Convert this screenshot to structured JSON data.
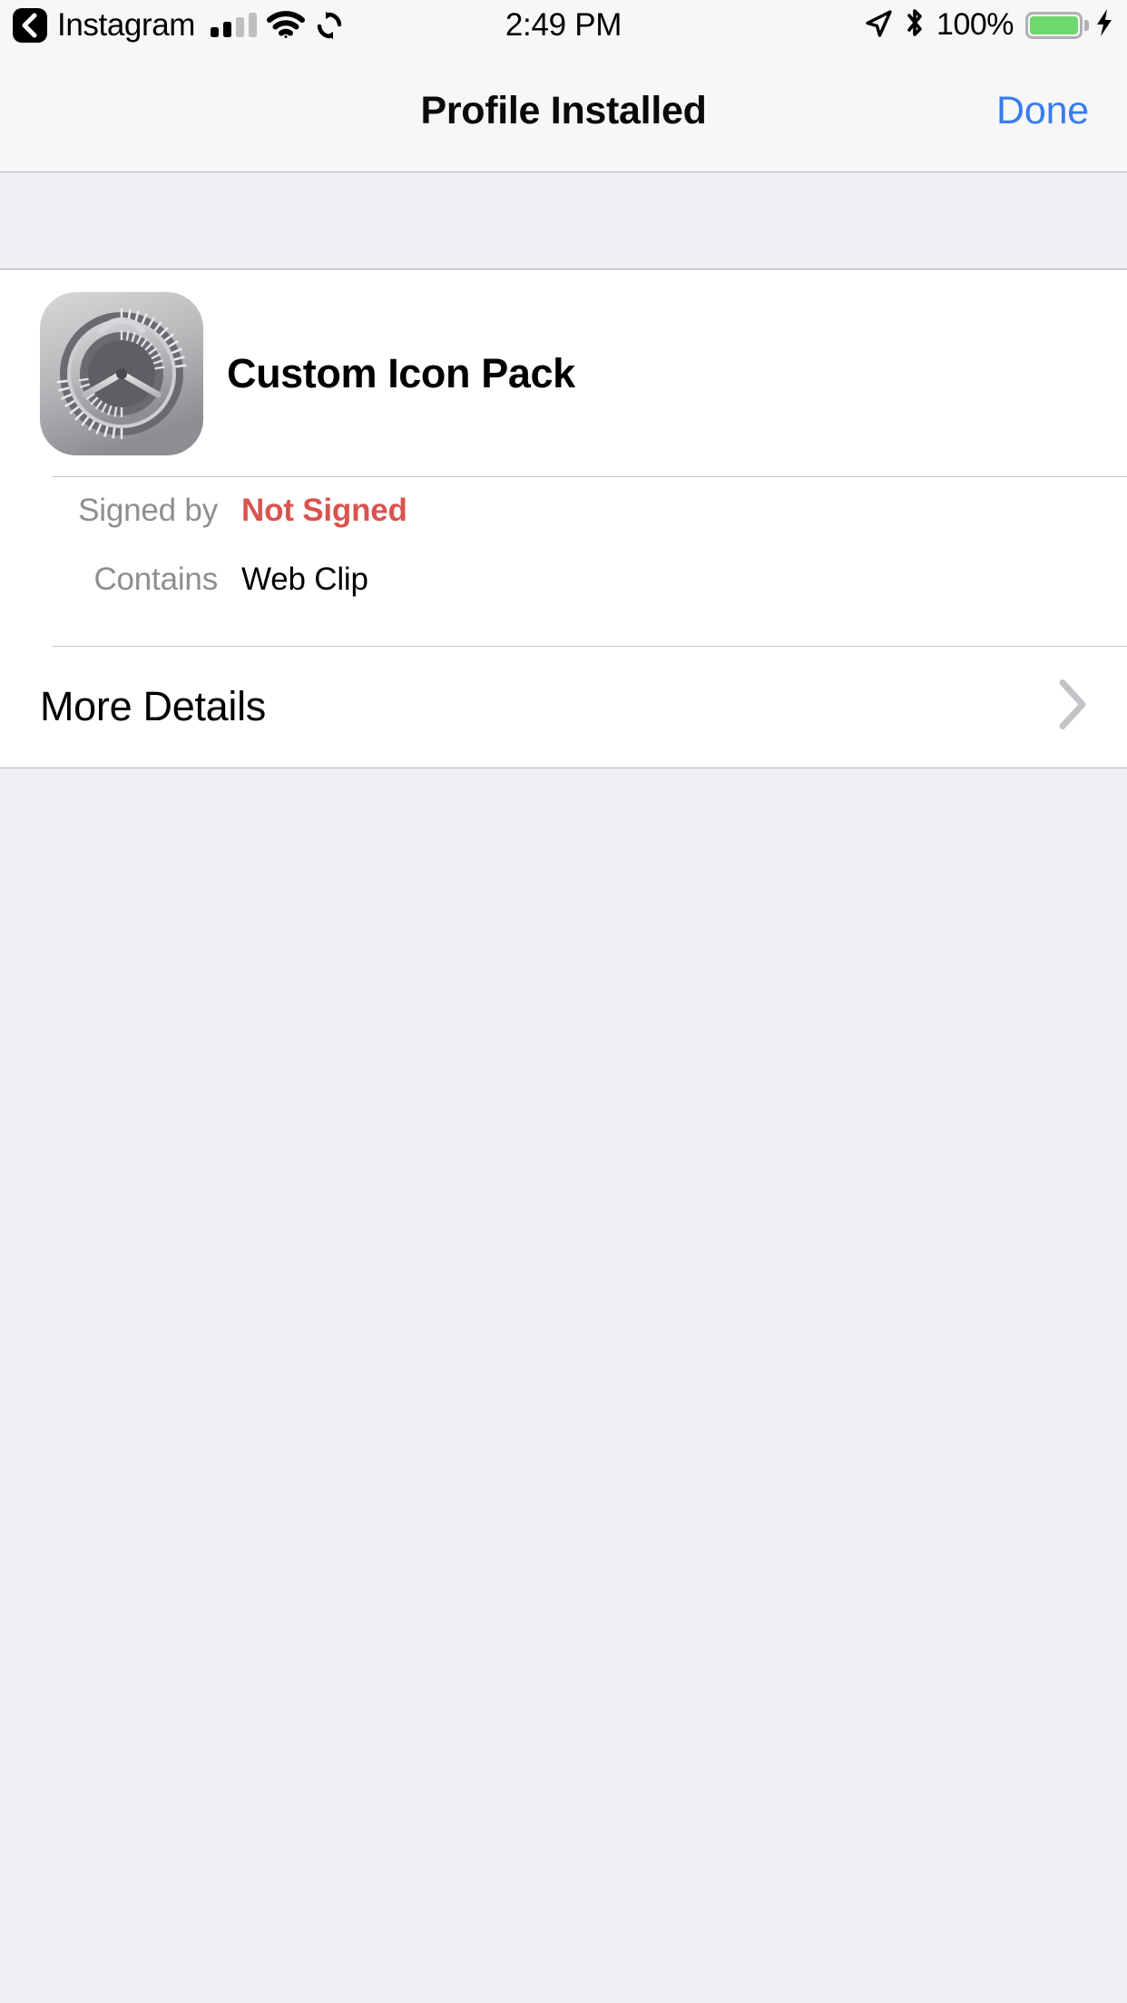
{
  "status_bar": {
    "back_label": "Instagram",
    "back_icon": "chevron-left-icon",
    "signal_icon": "cellular-signal-icon",
    "signal_bars_filled": 2,
    "signal_bars_total": 4,
    "wifi_icon": "wifi-icon",
    "sync_icon": "rotation-lock-sync-icon",
    "time": "2:49 PM",
    "location_icon": "location-arrow-icon",
    "bluetooth_icon": "bluetooth-icon",
    "battery_percent": "100%",
    "battery_icon": "battery-full-icon",
    "charging_icon": "lightning-bolt-icon",
    "battery_color": "#6ed86e"
  },
  "nav_bar": {
    "title": "Profile Installed",
    "done_label": "Done",
    "done_color": "#3a7cf0"
  },
  "profile": {
    "icon_name": "settings-gear-icon",
    "name": "Custom Icon Pack",
    "details": [
      {
        "label": "Signed by",
        "value": "Not Signed",
        "style": "warn",
        "color": "#d9544e"
      },
      {
        "label": "Contains",
        "value": "Web Clip",
        "style": "normal",
        "color": "#000000"
      }
    ],
    "more_details_label": "More Details",
    "disclosure_icon": "chevron-right-icon"
  }
}
